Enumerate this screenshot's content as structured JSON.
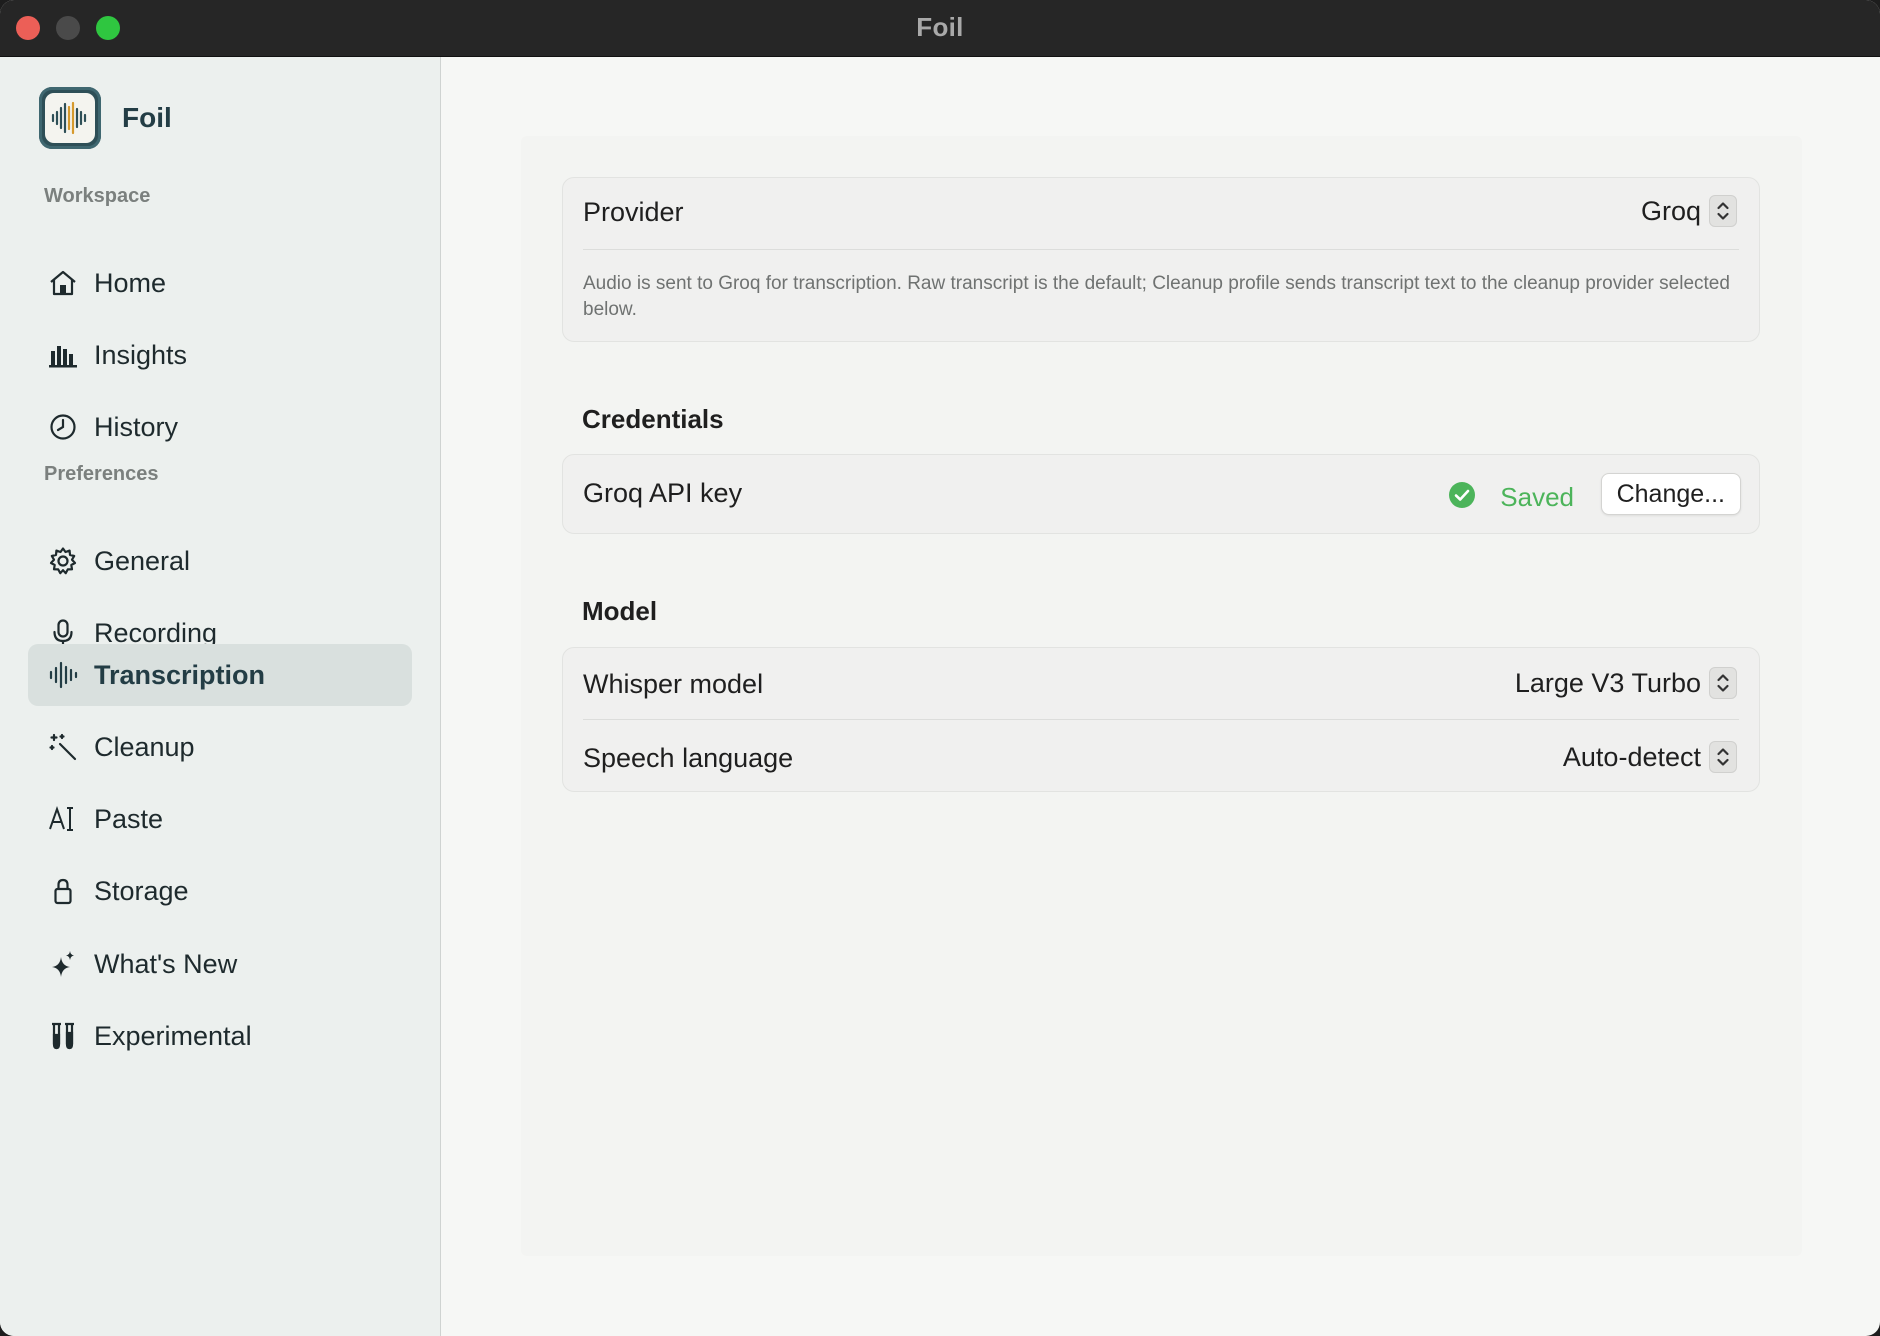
{
  "window": {
    "title": "Foil"
  },
  "sidebar": {
    "app_name": "Foil",
    "sections": [
      {
        "label": "Workspace",
        "items": [
          {
            "label": "Home",
            "icon": "house-icon"
          },
          {
            "label": "Insights",
            "icon": "bar-chart-icon"
          },
          {
            "label": "History",
            "icon": "clock-icon"
          }
        ]
      },
      {
        "label": "Preferences",
        "items": [
          {
            "label": "General",
            "icon": "gear-icon"
          },
          {
            "label": "Recording",
            "icon": "microphone-icon"
          },
          {
            "label": "Transcription",
            "icon": "waveform-icon",
            "active": true
          },
          {
            "label": "Cleanup",
            "icon": "magic-wand-icon"
          },
          {
            "label": "Paste",
            "icon": "text-cursor-icon"
          },
          {
            "label": "Storage",
            "icon": "lock-icon"
          },
          {
            "label": "What's New",
            "icon": "sparkles-icon"
          },
          {
            "label": "Experimental",
            "icon": "test-tubes-icon"
          }
        ]
      }
    ]
  },
  "provider": {
    "label": "Provider",
    "value": "Groq",
    "description": "Audio is sent to Groq for transcription. Raw transcript is the default; Cleanup profile sends transcript text to the cleanup provider selected below."
  },
  "credentials": {
    "heading": "Credentials",
    "api_key_label": "Groq API key",
    "status": "Saved",
    "change_button": "Change..."
  },
  "model": {
    "heading": "Model",
    "whisper_label": "Whisper model",
    "whisper_value": "Large V3 Turbo",
    "language_label": "Speech language",
    "language_value": "Auto-detect"
  },
  "colors": {
    "accent": "#233d45",
    "success": "#4cb45a",
    "sidebar_bg": "#ecf0ee",
    "selected_bg": "#d9e0de"
  }
}
